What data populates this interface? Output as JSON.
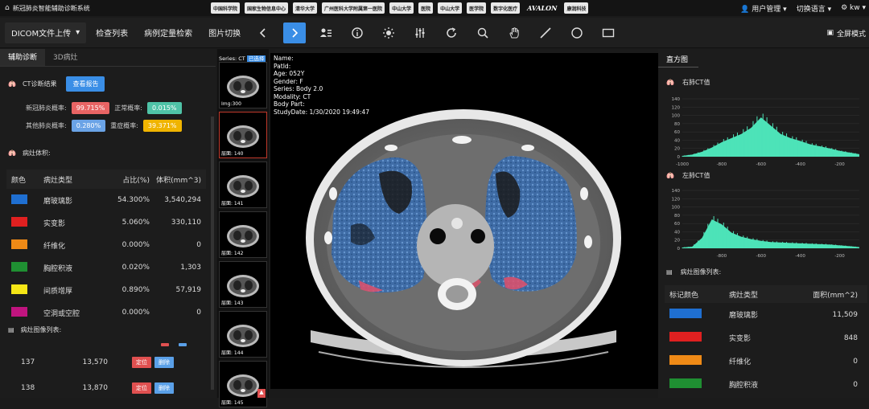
{
  "app": {
    "title": "新冠肺炎智能辅助诊断系统"
  },
  "logos": [
    "中国科学院",
    "国家生物信息中心",
    "清华大学",
    "广州医科大学附属第一医院",
    "中山大学",
    "医院",
    "中山大学",
    "医学院",
    "数字化医疗",
    "AVALON",
    "康润科技"
  ],
  "user_menu": {
    "admin": "用户管理",
    "language": "切换语言",
    "user": "kw"
  },
  "toolbar": {
    "upload": "DICOM文件上传",
    "check_list": "检查列表",
    "case_search": "病例定量检索",
    "image_switch": "图片切换",
    "fullscreen": "全屏模式"
  },
  "left_panel": {
    "tabs": [
      "辅助诊断",
      "3D病灶"
    ],
    "ct_result_label": "CT诊断结果",
    "view_report": "查看报告",
    "probs": [
      {
        "label": "新冠肺炎概率:",
        "value": "99.715%",
        "color": "#e86464"
      },
      {
        "label": "正常概率:",
        "value": "0.015%",
        "color": "#4fc3a7"
      },
      {
        "label": "其他肺炎概率:",
        "value": "0.280%",
        "color": "#6aa3e6"
      },
      {
        "label": "重症概率:",
        "value": "39.371%",
        "color": "#f0b400"
      }
    ],
    "volume_label": "病灶体积:",
    "table_headers": [
      "颜色",
      "病灶类型",
      "占比(%)",
      "体积(mm^3)"
    ],
    "lesions": [
      {
        "color": "#1f6fd1",
        "type": "磨玻璃影",
        "pct": "54.300%",
        "vol": "3,540,294"
      },
      {
        "color": "#e02020",
        "type": "实变影",
        "pct": "5.060%",
        "vol": "330,110"
      },
      {
        "color": "#ef8a16",
        "type": "纤维化",
        "pct": "0.000%",
        "vol": "0"
      },
      {
        "color": "#1f8f32",
        "type": "胸腔积液",
        "pct": "0.020%",
        "vol": "1,303"
      },
      {
        "color": "#f5e616",
        "type": "间质增厚",
        "pct": "0.890%",
        "vol": "57,919"
      },
      {
        "color": "#c0147f",
        "type": "空洞或空腔",
        "pct": "0.000%",
        "vol": "0"
      }
    ],
    "image_list_label": "病灶图像列表:",
    "image_rows": [
      {
        "idx": "137",
        "area": "13,570",
        "b1": "定位",
        "b2": "删除"
      },
      {
        "idx": "138",
        "area": "13,870",
        "b1": "定位",
        "b2": "删除"
      }
    ]
  },
  "thumbnails": [
    {
      "label": "Img:300"
    },
    {
      "label": "层面: 140"
    },
    {
      "label": "层面: 141"
    },
    {
      "label": "层面: 142"
    },
    {
      "label": "层面: 143"
    },
    {
      "label": "层面: 144"
    },
    {
      "label": "层面: 145"
    }
  ],
  "thumb_header": {
    "series": "Series: CT",
    "badge": "已选择"
  },
  "viewer": {
    "name": "Name:",
    "patid": "PatId:",
    "age": "Age: 052Y",
    "gender": "Gender: F",
    "series": "Series: Body 2.0",
    "modality": "Modality: CT",
    "body_part": "Body Part:",
    "study_date": "StudyDate: 1/30/2020 19:49:47"
  },
  "right_panel": {
    "title": "直方图",
    "right_lung": "右肺CT值",
    "left_lung": "左肺CT值",
    "list_label": "病灶图像列表:",
    "table_headers": [
      "标记颜色",
      "病灶类型",
      "面积(mm^2)"
    ],
    "rows": [
      {
        "color": "#1f6fd1",
        "type": "磨玻璃影",
        "area": "11,509"
      },
      {
        "color": "#e02020",
        "type": "实变影",
        "area": "848"
      },
      {
        "color": "#ef8a16",
        "type": "纤维化",
        "area": "0"
      },
      {
        "color": "#1f8f32",
        "type": "胸腔积液",
        "area": "0"
      }
    ]
  },
  "chart_data": [
    {
      "type": "area",
      "x_ticks": [
        "-1000",
        "-800",
        "-600",
        "-400",
        "-200"
      ],
      "y_ticks": [
        "0",
        "20",
        "40",
        "60",
        "80",
        "100",
        "120",
        "140"
      ],
      "ylim": [
        0,
        140
      ],
      "xlim": [
        -1000,
        -100
      ],
      "x": [
        -1000,
        -950,
        -900,
        -850,
        -800,
        -750,
        -700,
        -650,
        -600,
        -550,
        -500,
        -450,
        -400,
        -350,
        -300,
        -250,
        -200,
        -150,
        -100
      ],
      "values": [
        2,
        5,
        12,
        22,
        35,
        45,
        55,
        70,
        95,
        75,
        55,
        45,
        38,
        30,
        25,
        20,
        14,
        10,
        6
      ],
      "color": "#4de3b8"
    },
    {
      "type": "area",
      "x_ticks": [
        "-800",
        "-600",
        "-400",
        "-200"
      ],
      "y_ticks": [
        "0",
        "20",
        "40",
        "60",
        "80",
        "100",
        "120",
        "140"
      ],
      "ylim": [
        0,
        140
      ],
      "xlim": [
        -1000,
        -100
      ],
      "x": [
        -1000,
        -950,
        -900,
        -850,
        -800,
        -750,
        -700,
        -650,
        -600,
        -550,
        -500,
        -450,
        -400,
        -350,
        -300,
        -250,
        -200,
        -150,
        -100
      ],
      "values": [
        2,
        4,
        25,
        70,
        58,
        38,
        28,
        22,
        18,
        15,
        14,
        13,
        12,
        11,
        10,
        9,
        7,
        5,
        3
      ],
      "color": "#4de3b8"
    }
  ]
}
